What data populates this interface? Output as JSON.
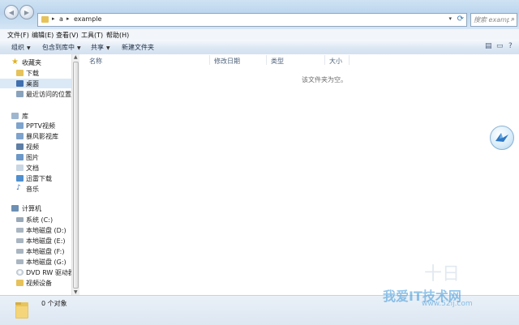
{
  "address": {
    "crumbs": [
      "a",
      "example"
    ],
    "separator": "▸"
  },
  "search": {
    "placeholder": "搜索 example"
  },
  "menu": [
    "文件(F)",
    "编辑(E)",
    "查看(V)",
    "工具(T)",
    "帮助(H)"
  ],
  "toolbar": {
    "organize": "组织",
    "include_library": "包含到库中",
    "share": "共享",
    "new_folder": "新建文件夹"
  },
  "nav": {
    "favorites": {
      "label": "收藏夹",
      "items": [
        "下载",
        "桌面",
        "最近访问的位置"
      ]
    },
    "library": {
      "label": "库",
      "items": [
        "PPTV视频",
        "暴风影视库",
        "视频",
        "图片",
        "文档",
        "迅雷下载",
        "音乐"
      ]
    },
    "computer": {
      "label": "计算机",
      "items": [
        "系统 (C:)",
        "本地磁盘 (D:)",
        "本地磁盘 (E:)",
        "本地磁盘 (F:)",
        "本地磁盘 (G:)",
        "DVD RW 驱动器 ...",
        "视频设备"
      ]
    }
  },
  "columns": [
    "名称",
    "修改日期",
    "类型",
    "大小"
  ],
  "empty_message": "该文件夹为空。",
  "status": {
    "count": "0 个对象"
  },
  "watermark": {
    "brand": "我爱IT技术网",
    "url": "www.52ij.com"
  },
  "colors": {
    "selection": "#dbe9f7",
    "folder": "#e6c25a",
    "accent": "#3a7ab6"
  }
}
